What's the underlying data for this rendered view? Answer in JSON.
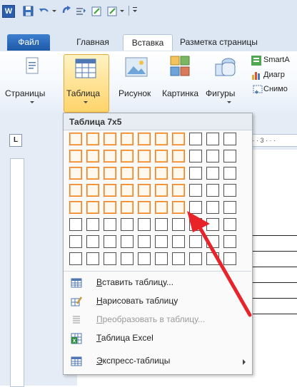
{
  "qat": {
    "word_icon": "W",
    "icons": [
      "save-icon",
      "undo-icon",
      "redo-icon",
      "format-icon",
      "customize-icon"
    ]
  },
  "tabs": [
    "Файл",
    "Главная",
    "Вставка",
    "Разметка страницы"
  ],
  "ribbon": {
    "pages_label": "Страницы",
    "table_label": "Таблица",
    "picture_label": "Рисунок",
    "clipart_label": "Картинка",
    "shapes_label": "Фигуры",
    "smartart_label": "SmartA",
    "chart_label": "Диагр",
    "screenshot_label": "Снимо"
  },
  "ruler_text": "· · · 3 · · ·",
  "menu": {
    "header": "Таблица 7x5",
    "grid": {
      "cols": 10,
      "rows": 8,
      "selected_cols": 7,
      "selected_rows": 5
    },
    "items": [
      {
        "first": "В",
        "rest": "ставить таблицу...",
        "icon": "insert-table-icon",
        "disabled": false,
        "submenu": false
      },
      {
        "first": "Н",
        "rest": "арисовать таблицу",
        "icon": "draw-table-icon",
        "disabled": false,
        "submenu": false
      },
      {
        "first": "П",
        "rest": "реобразовать в таблицу...",
        "icon": "convert-text-icon",
        "disabled": true,
        "submenu": false
      },
      {
        "first": "Т",
        "rest": "аблица Excel",
        "icon": "excel-table-icon",
        "disabled": false,
        "submenu": false
      },
      {
        "first": "Э",
        "rest": "кспресс-таблицы",
        "icon": "quick-tables-icon",
        "disabled": false,
        "submenu": true
      }
    ]
  },
  "colors": {
    "accent": "#1d5aa8",
    "highlight": "#f57c1f",
    "annotation_arrow": "#e8232a"
  }
}
